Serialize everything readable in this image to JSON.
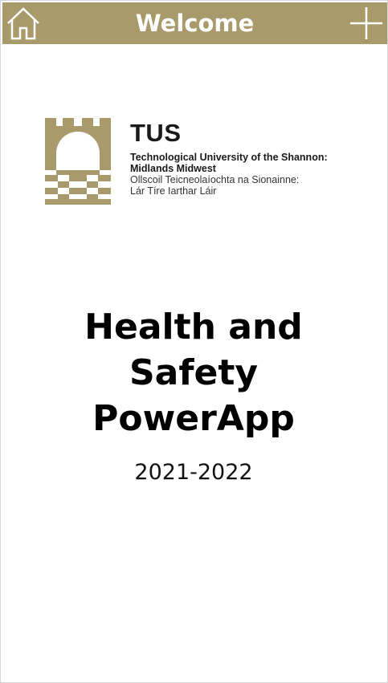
{
  "header": {
    "title": "Welcome",
    "background_color": "#a99a6b",
    "left_icon": "home-icon",
    "right_icon": "plus-icon"
  },
  "logo": {
    "abbreviation": "TUS",
    "line1": "Technological University of the Shannon:",
    "line2": "Midlands Midwest",
    "line3": "Ollscoil Teicneolaíochta na Sionainne:",
    "line4": "Lár Tíre Iarthar Láir",
    "mark_color": "#a99a6b"
  },
  "main": {
    "title_lines": [
      "Health and",
      "Safety",
      "PowerApp"
    ],
    "year": "2021-2022"
  }
}
